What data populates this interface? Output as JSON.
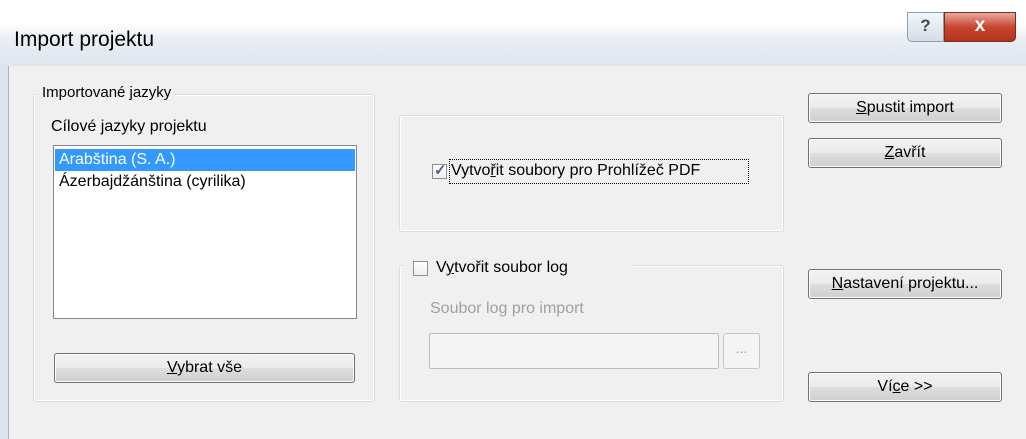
{
  "window": {
    "title": "Import projektu",
    "help_glyph": "?",
    "close_glyph": "x"
  },
  "languages_group": {
    "legend": "Importované jazyky",
    "list_label": "Cílové jazyky projektu",
    "items": [
      {
        "label": "Arabština (S. A.)",
        "selected": true
      },
      {
        "label": "Ázerbajdžánština (cyrilika)",
        "selected": false
      }
    ],
    "select_all": {
      "before": "",
      "mnemonic": "V",
      "after": "ybrat vše"
    }
  },
  "pdf_option": {
    "checked": true,
    "check_glyph": "✓",
    "label": {
      "before": "Vytvo",
      "mnemonic": "ř",
      "after": "it soubory pro Prohlížeč PDF"
    }
  },
  "log_group": {
    "checked": false,
    "label": {
      "before": "V",
      "mnemonic": "y",
      "after": "tvořit soubor log"
    },
    "field_label": "Soubor log pro import",
    "field_value": "",
    "browse_label": "..."
  },
  "buttons": {
    "start_import": {
      "before": "",
      "mnemonic": "S",
      "after": "pustit import"
    },
    "close": {
      "before": "",
      "mnemonic": "Z",
      "after": "avřít"
    },
    "project_settings": {
      "before": "",
      "mnemonic": "N",
      "after": "astavení projektu..."
    },
    "more": {
      "before": "Ví",
      "mnemonic": "c",
      "after": "e >>"
    }
  },
  "colors": {
    "selection": "#3399ff",
    "close_button": "#c7462f",
    "dialog_background": "#f0f0f0"
  }
}
